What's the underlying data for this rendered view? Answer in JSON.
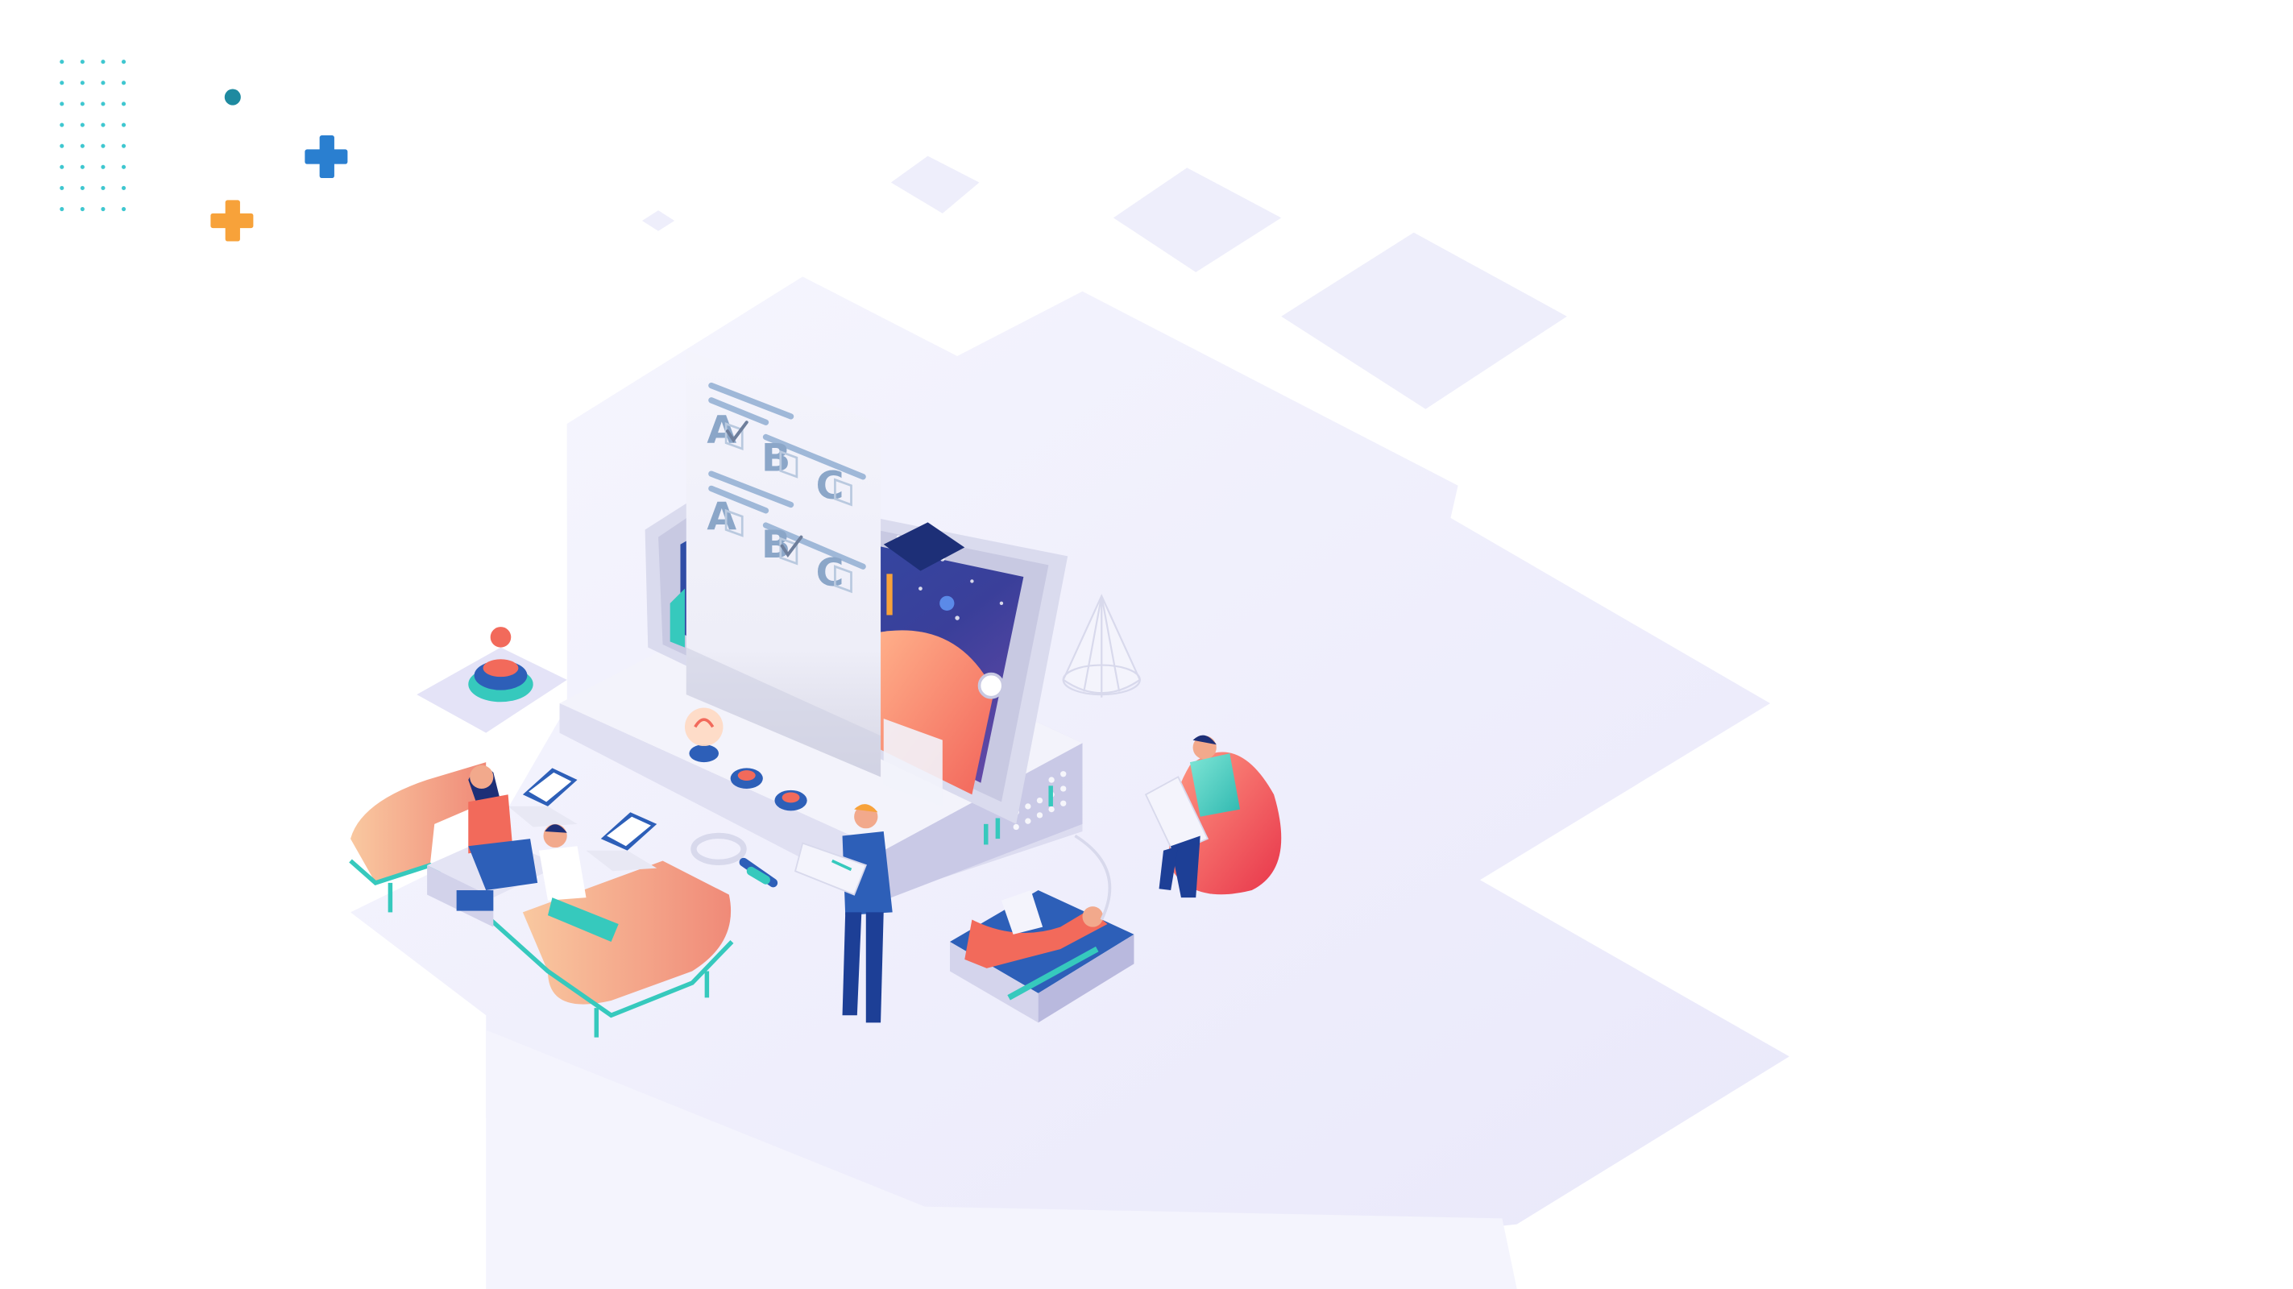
{
  "illustration": {
    "quiz_sheet": {
      "questions": [
        {
          "options": [
            {
              "letter": "A",
              "checked": true
            },
            {
              "letter": "B",
              "checked": false
            },
            {
              "letter": "C",
              "checked": false
            }
          ]
        },
        {
          "options": [
            {
              "letter": "A",
              "checked": false
            },
            {
              "letter": "B",
              "checked": true
            },
            {
              "letter": "C",
              "checked": false
            }
          ]
        }
      ]
    },
    "colors": {
      "background": "#ffffff",
      "platform": "#eeeefb",
      "accent_blue": "#2d5fb8",
      "accent_teal": "#36c9bd",
      "accent_orange": "#f7a23a",
      "accent_coral": "#f26a5b",
      "paper": "#f2f3fb"
    }
  }
}
